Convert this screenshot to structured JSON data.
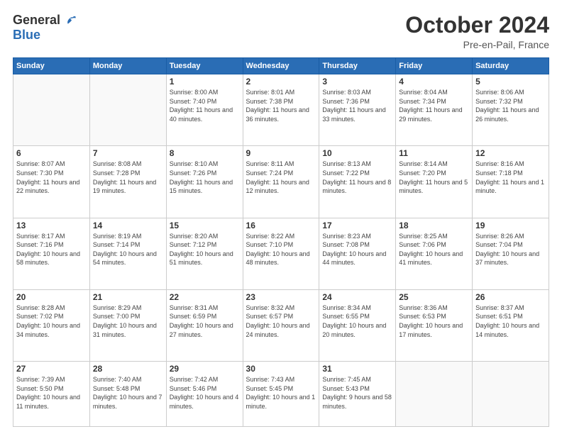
{
  "header": {
    "logo": {
      "general": "General",
      "blue": "Blue"
    },
    "title": "October 2024",
    "location": "Pre-en-Pail, France"
  },
  "days_header": [
    "Sunday",
    "Monday",
    "Tuesday",
    "Wednesday",
    "Thursday",
    "Friday",
    "Saturday"
  ],
  "weeks": [
    [
      {
        "day": "",
        "info": ""
      },
      {
        "day": "",
        "info": ""
      },
      {
        "day": "1",
        "info": "Sunrise: 8:00 AM\nSunset: 7:40 PM\nDaylight: 11 hours\nand 40 minutes."
      },
      {
        "day": "2",
        "info": "Sunrise: 8:01 AM\nSunset: 7:38 PM\nDaylight: 11 hours\nand 36 minutes."
      },
      {
        "day": "3",
        "info": "Sunrise: 8:03 AM\nSunset: 7:36 PM\nDaylight: 11 hours\nand 33 minutes."
      },
      {
        "day": "4",
        "info": "Sunrise: 8:04 AM\nSunset: 7:34 PM\nDaylight: 11 hours\nand 29 minutes."
      },
      {
        "day": "5",
        "info": "Sunrise: 8:06 AM\nSunset: 7:32 PM\nDaylight: 11 hours\nand 26 minutes."
      }
    ],
    [
      {
        "day": "6",
        "info": "Sunrise: 8:07 AM\nSunset: 7:30 PM\nDaylight: 11 hours\nand 22 minutes."
      },
      {
        "day": "7",
        "info": "Sunrise: 8:08 AM\nSunset: 7:28 PM\nDaylight: 11 hours\nand 19 minutes."
      },
      {
        "day": "8",
        "info": "Sunrise: 8:10 AM\nSunset: 7:26 PM\nDaylight: 11 hours\nand 15 minutes."
      },
      {
        "day": "9",
        "info": "Sunrise: 8:11 AM\nSunset: 7:24 PM\nDaylight: 11 hours\nand 12 minutes."
      },
      {
        "day": "10",
        "info": "Sunrise: 8:13 AM\nSunset: 7:22 PM\nDaylight: 11 hours\nand 8 minutes."
      },
      {
        "day": "11",
        "info": "Sunrise: 8:14 AM\nSunset: 7:20 PM\nDaylight: 11 hours\nand 5 minutes."
      },
      {
        "day": "12",
        "info": "Sunrise: 8:16 AM\nSunset: 7:18 PM\nDaylight: 11 hours\nand 1 minute."
      }
    ],
    [
      {
        "day": "13",
        "info": "Sunrise: 8:17 AM\nSunset: 7:16 PM\nDaylight: 10 hours\nand 58 minutes."
      },
      {
        "day": "14",
        "info": "Sunrise: 8:19 AM\nSunset: 7:14 PM\nDaylight: 10 hours\nand 54 minutes."
      },
      {
        "day": "15",
        "info": "Sunrise: 8:20 AM\nSunset: 7:12 PM\nDaylight: 10 hours\nand 51 minutes."
      },
      {
        "day": "16",
        "info": "Sunrise: 8:22 AM\nSunset: 7:10 PM\nDaylight: 10 hours\nand 48 minutes."
      },
      {
        "day": "17",
        "info": "Sunrise: 8:23 AM\nSunset: 7:08 PM\nDaylight: 10 hours\nand 44 minutes."
      },
      {
        "day": "18",
        "info": "Sunrise: 8:25 AM\nSunset: 7:06 PM\nDaylight: 10 hours\nand 41 minutes."
      },
      {
        "day": "19",
        "info": "Sunrise: 8:26 AM\nSunset: 7:04 PM\nDaylight: 10 hours\nand 37 minutes."
      }
    ],
    [
      {
        "day": "20",
        "info": "Sunrise: 8:28 AM\nSunset: 7:02 PM\nDaylight: 10 hours\nand 34 minutes."
      },
      {
        "day": "21",
        "info": "Sunrise: 8:29 AM\nSunset: 7:00 PM\nDaylight: 10 hours\nand 31 minutes."
      },
      {
        "day": "22",
        "info": "Sunrise: 8:31 AM\nSunset: 6:59 PM\nDaylight: 10 hours\nand 27 minutes."
      },
      {
        "day": "23",
        "info": "Sunrise: 8:32 AM\nSunset: 6:57 PM\nDaylight: 10 hours\nand 24 minutes."
      },
      {
        "day": "24",
        "info": "Sunrise: 8:34 AM\nSunset: 6:55 PM\nDaylight: 10 hours\nand 20 minutes."
      },
      {
        "day": "25",
        "info": "Sunrise: 8:36 AM\nSunset: 6:53 PM\nDaylight: 10 hours\nand 17 minutes."
      },
      {
        "day": "26",
        "info": "Sunrise: 8:37 AM\nSunset: 6:51 PM\nDaylight: 10 hours\nand 14 minutes."
      }
    ],
    [
      {
        "day": "27",
        "info": "Sunrise: 7:39 AM\nSunset: 5:50 PM\nDaylight: 10 hours\nand 11 minutes."
      },
      {
        "day": "28",
        "info": "Sunrise: 7:40 AM\nSunset: 5:48 PM\nDaylight: 10 hours\nand 7 minutes."
      },
      {
        "day": "29",
        "info": "Sunrise: 7:42 AM\nSunset: 5:46 PM\nDaylight: 10 hours\nand 4 minutes."
      },
      {
        "day": "30",
        "info": "Sunrise: 7:43 AM\nSunset: 5:45 PM\nDaylight: 10 hours\nand 1 minute."
      },
      {
        "day": "31",
        "info": "Sunrise: 7:45 AM\nSunset: 5:43 PM\nDaylight: 9 hours\nand 58 minutes."
      },
      {
        "day": "",
        "info": ""
      },
      {
        "day": "",
        "info": ""
      }
    ]
  ]
}
